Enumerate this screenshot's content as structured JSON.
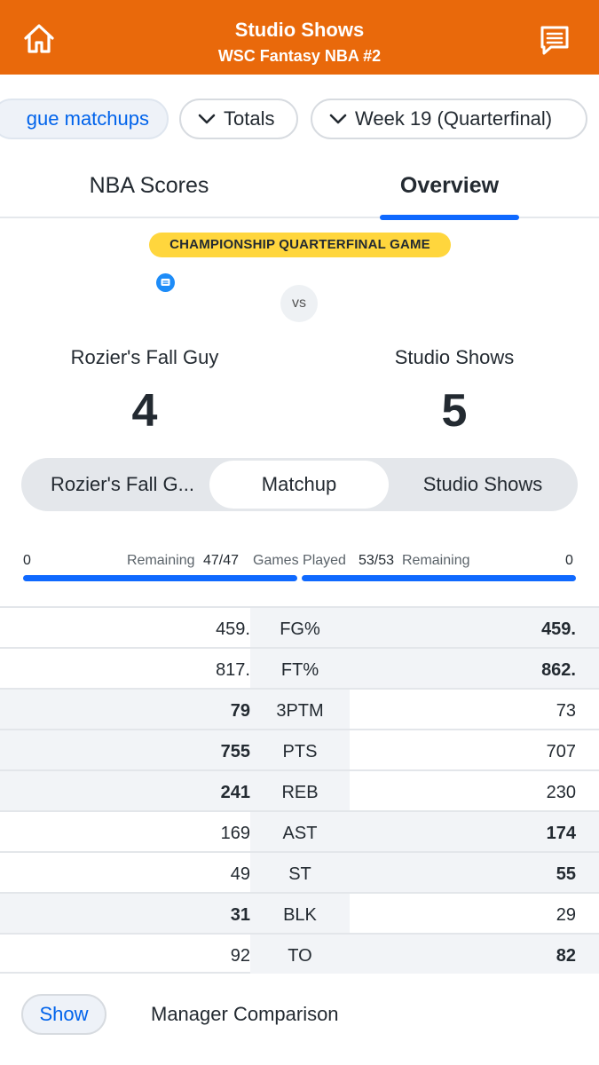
{
  "header": {
    "title": "Studio Shows",
    "subtitle": "WSC Fantasy NBA #2",
    "home_icon": "home-icon",
    "chat_icon": "chat-icon"
  },
  "filters": {
    "league_label": "gue matchups",
    "totals_label": "Totals",
    "week_label": "Week 19 (Quarterfinal)"
  },
  "tabs": [
    {
      "label": "NBA Scores",
      "active": false
    },
    {
      "label": "Overview",
      "active": true
    }
  ],
  "matchup": {
    "badge": "CHAMPIONSHIP QUARTERFINAL GAME",
    "vs": "vs",
    "left_team": {
      "name": "Rozier's Fall Guy",
      "score": "4"
    },
    "right_team": {
      "name": "Studio Shows",
      "score": "5"
    }
  },
  "segments": [
    "Rozier's Fall G...",
    "Matchup",
    "Studio Shows"
  ],
  "games": {
    "left_remaining_value": "0",
    "left_remaining_label": "Remaining",
    "left_played": "47/47",
    "center_label": "Games Played",
    "right_played": "53/53",
    "right_remaining_label": "Remaining",
    "right_remaining_value": "0"
  },
  "stats": [
    {
      "cat": "FG%",
      "left": "459.",
      "right": "459.",
      "winner": "right"
    },
    {
      "cat": "FT%",
      "left": "817.",
      "right": "862.",
      "winner": "right"
    },
    {
      "cat": "3PTM",
      "left": "79",
      "right": "73",
      "winner": "left"
    },
    {
      "cat": "PTS",
      "left": "755",
      "right": "707",
      "winner": "left"
    },
    {
      "cat": "REB",
      "left": "241",
      "right": "230",
      "winner": "left"
    },
    {
      "cat": "AST",
      "left": "169",
      "right": "174",
      "winner": "right"
    },
    {
      "cat": "ST",
      "left": "49",
      "right": "55",
      "winner": "right"
    },
    {
      "cat": "BLK",
      "left": "31",
      "right": "29",
      "winner": "left"
    },
    {
      "cat": "TO",
      "left": "92",
      "right": "82",
      "winner": "right"
    }
  ],
  "footer": {
    "show_label": "Show",
    "comparison_label": "Manager Comparison"
  },
  "colors": {
    "header": "#e9690b",
    "accent": "#0f69ff",
    "badge": "#ffd63d"
  }
}
